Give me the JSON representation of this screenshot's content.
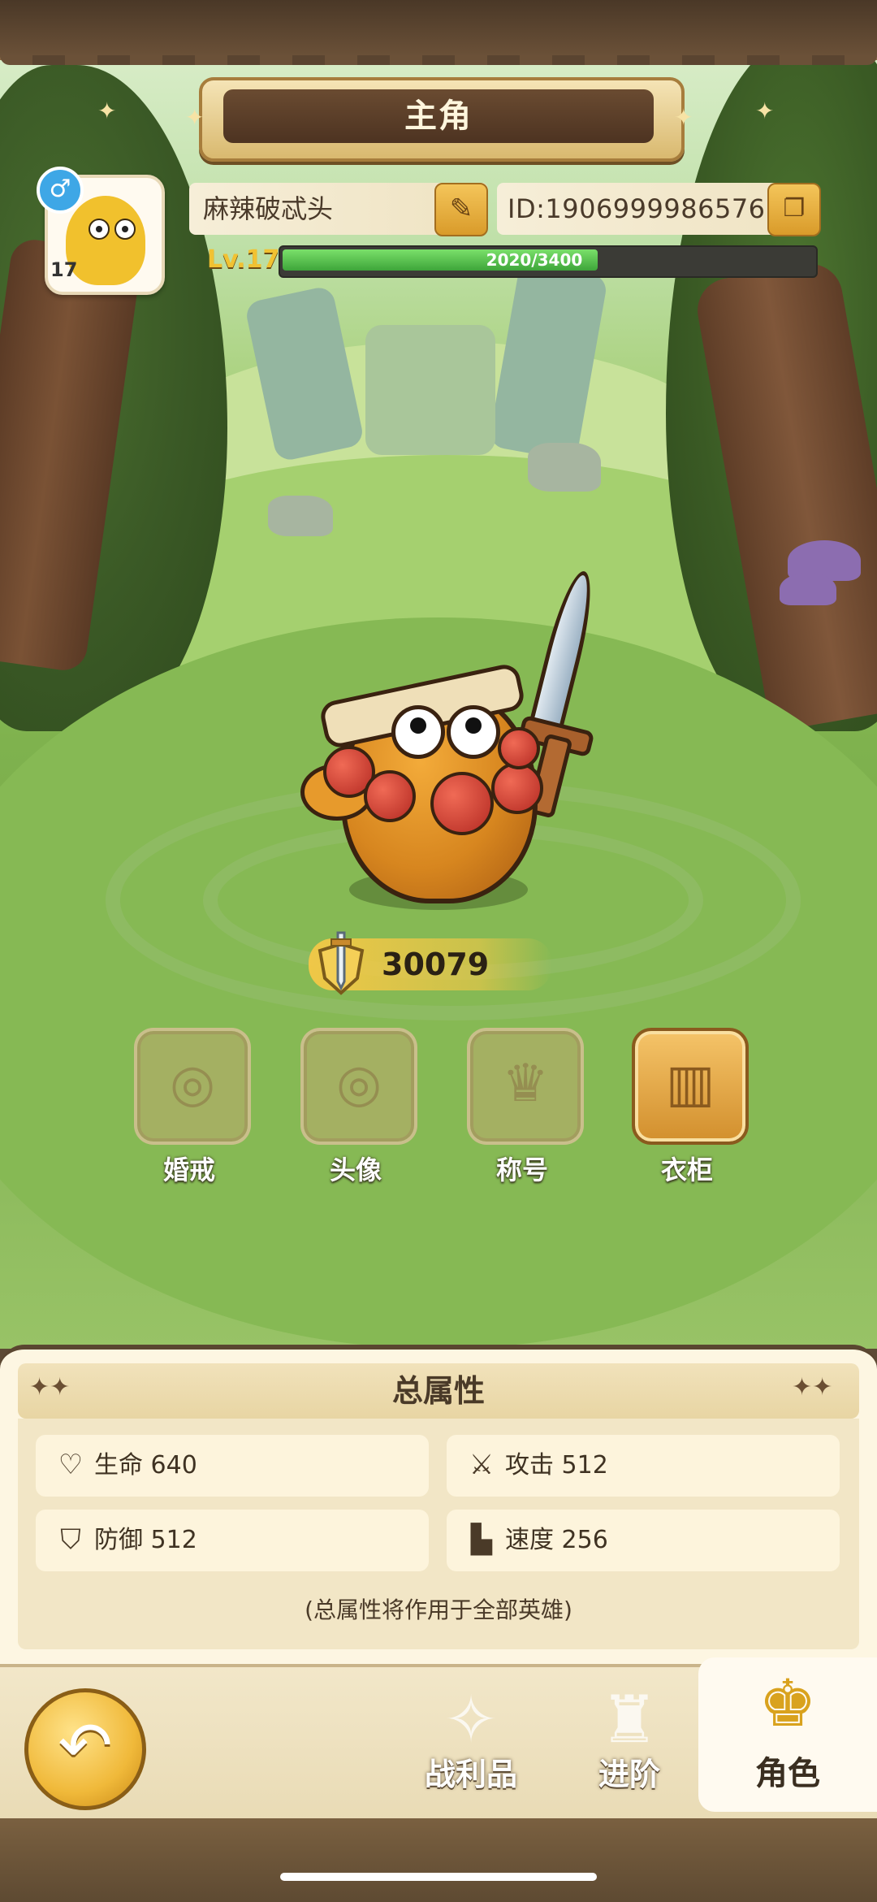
{
  "header": {
    "title": "主角"
  },
  "profile": {
    "gender_symbol": "♂",
    "avatar_level": "17",
    "name": "麻辣破忒头",
    "id_text": "ID:1906999986576",
    "level_label": "Lv.17",
    "xp_text": "2020/3400",
    "xp_fraction": 0.594
  },
  "power": {
    "value": "30079"
  },
  "features": [
    {
      "label": "婚戒",
      "icon": "ring-icon"
    },
    {
      "label": "头像",
      "icon": "portrait-ring-icon"
    },
    {
      "label": "称号",
      "icon": "crown-title-icon"
    },
    {
      "label": "衣柜",
      "icon": "wardrobe-icon"
    }
  ],
  "attributes": {
    "title": "总属性",
    "stats": [
      {
        "icon": "heart-icon",
        "label": "生命 640"
      },
      {
        "icon": "attack-icon",
        "label": "攻击 512"
      },
      {
        "icon": "shield-icon",
        "label": "防御 512"
      },
      {
        "icon": "boot-icon",
        "label": "速度 256"
      }
    ],
    "note": "(总属性将作用于全部英雄)"
  },
  "nav": {
    "items": [
      {
        "label": "战利品",
        "icon": "loot-icon"
      },
      {
        "label": "进阶",
        "icon": "advance-icon"
      },
      {
        "label": "角色",
        "icon": "character-icon",
        "active": true
      }
    ]
  }
}
